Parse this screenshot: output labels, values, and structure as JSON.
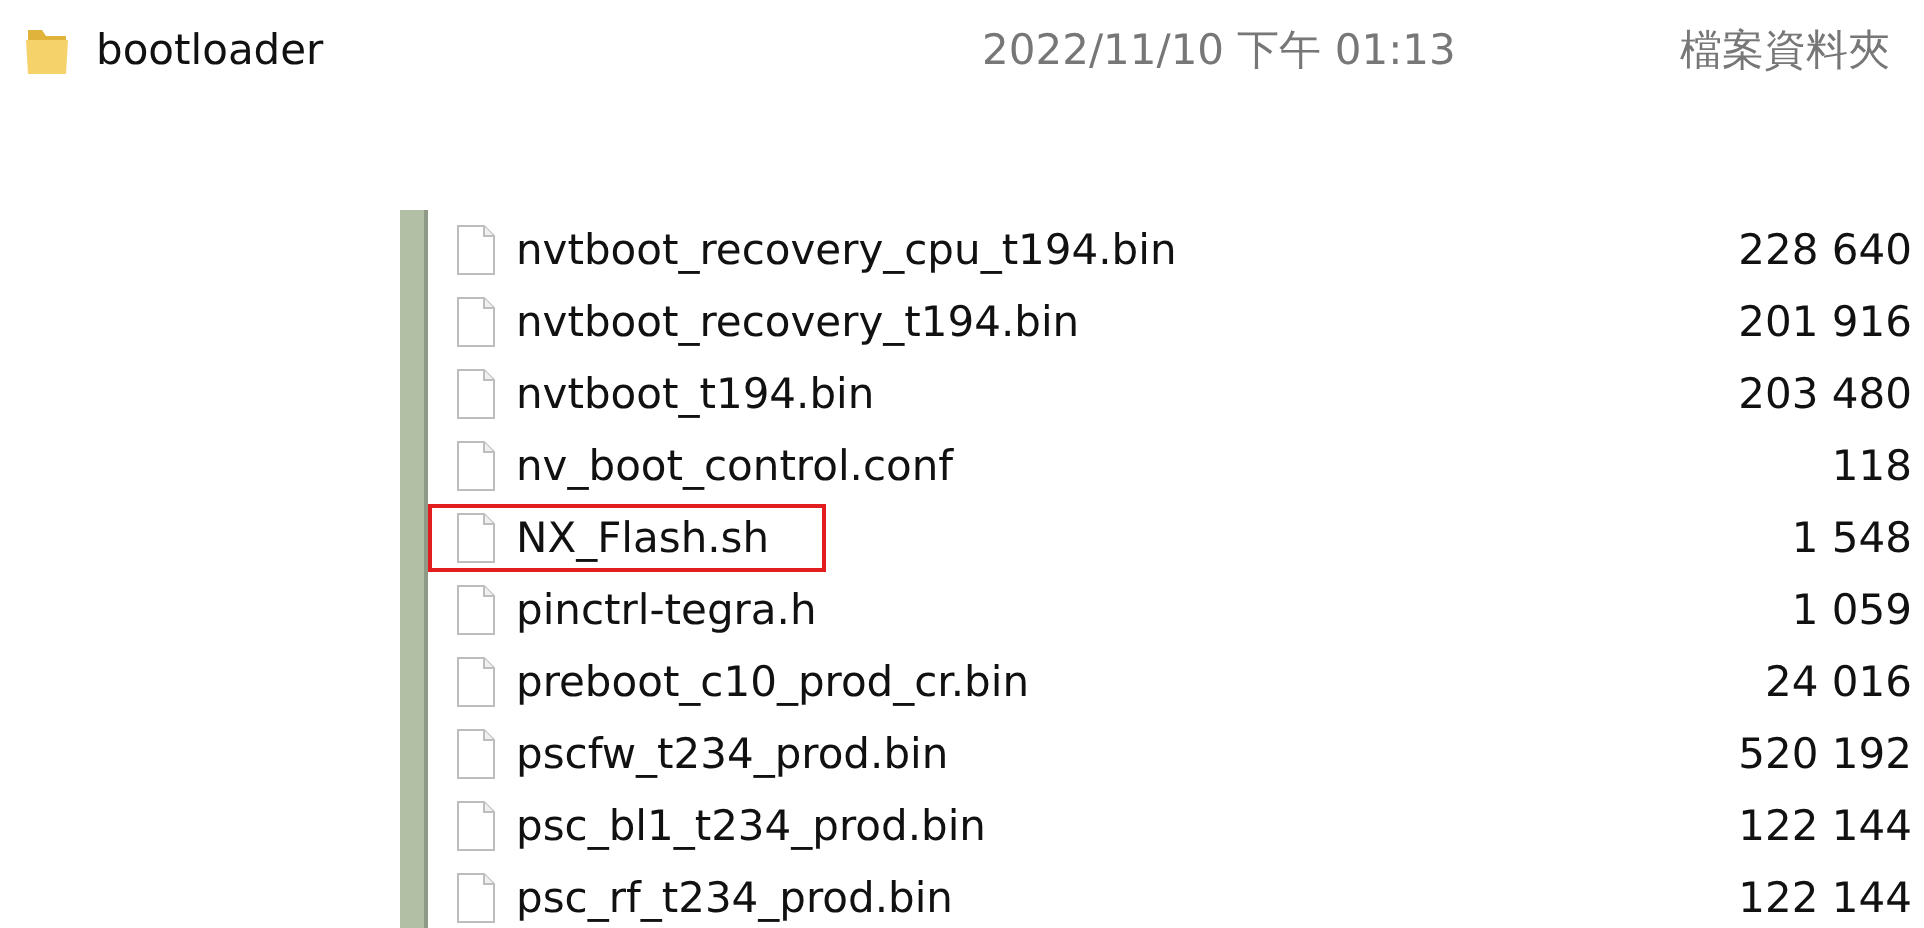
{
  "folder": {
    "name": "bootloader",
    "modified": "2022/11/10 下午 01:13",
    "type": "檔案資料夾"
  },
  "files": [
    {
      "name": "nvtboot_recovery_cpu_t194.bin",
      "size": "228 640",
      "highlighted": false
    },
    {
      "name": "nvtboot_recovery_t194.bin",
      "size": "201 916",
      "highlighted": false
    },
    {
      "name": "nvtboot_t194.bin",
      "size": "203 480",
      "highlighted": false
    },
    {
      "name": "nv_boot_control.conf",
      "size": "118",
      "highlighted": false
    },
    {
      "name": "NX_Flash.sh",
      "size": "1 548",
      "highlighted": true
    },
    {
      "name": "pinctrl-tegra.h",
      "size": "1 059",
      "highlighted": false
    },
    {
      "name": "preboot_c10_prod_cr.bin",
      "size": "24 016",
      "highlighted": false
    },
    {
      "name": "pscfw_t234_prod.bin",
      "size": "520 192",
      "highlighted": false
    },
    {
      "name": "psc_bl1_t234_prod.bin",
      "size": "122 144",
      "highlighted": false
    },
    {
      "name": "psc_rf_t234_prod.bin",
      "size": "122 144",
      "highlighted": false
    }
  ]
}
